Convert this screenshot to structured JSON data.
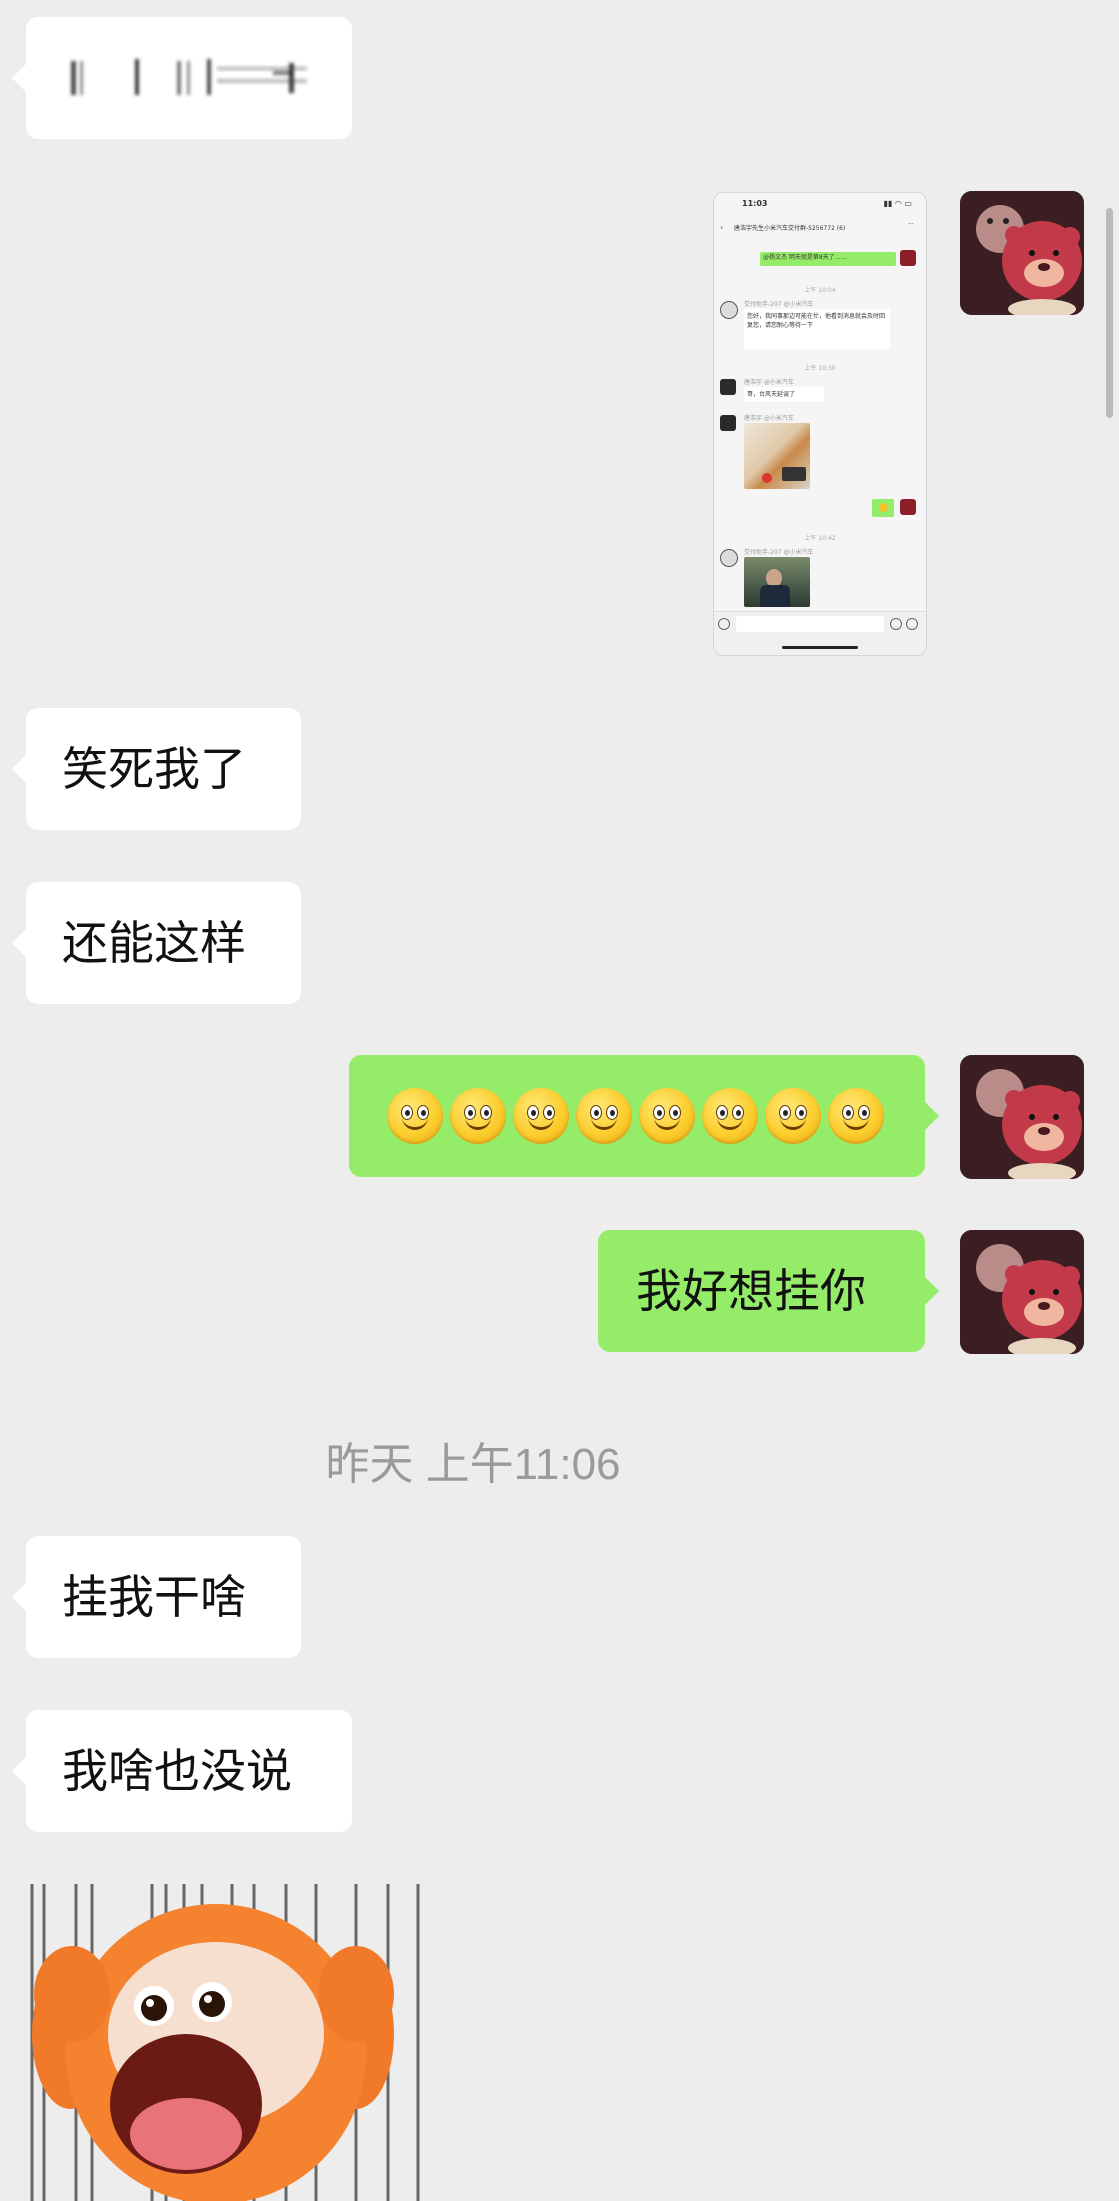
{
  "messages": [
    {
      "id": "m1",
      "side": "in",
      "text": "",
      "redacted": true
    },
    {
      "id": "m2",
      "side": "out",
      "type": "image",
      "screenshot": {
        "time": "11:03",
        "title": "唐浩宇先生小米汽车交付群-5256772 (6)",
        "msg_green": "@杨文杰 明天就是第8天了……",
        "time1": "上午 10:04",
        "sender1": "交付助手-207 @小米汽车",
        "text1": "您好，我同事那边可能在忙，他看到消息就会及时回复您，请您耐心等待一下",
        "time2": "上午 10:30",
        "sender2": "唐浩宇 @小米汽车",
        "text2": "哥，台风天延误了",
        "sender3": "唐浩宇 @小米汽车",
        "time3": "上午 10:42",
        "sender4": "交付助手-207 @小米汽车"
      }
    },
    {
      "id": "m3",
      "side": "in",
      "text": "笑死我了"
    },
    {
      "id": "m4",
      "side": "in",
      "text": "还能这样"
    },
    {
      "id": "m5",
      "side": "out",
      "type": "emoji",
      "emoji": "slightly-smiling-face",
      "count": 8
    },
    {
      "id": "m6",
      "side": "out",
      "text": "我好想挂你"
    },
    {
      "id": "m7",
      "side": "in",
      "text": "挂我干啥"
    },
    {
      "id": "m8",
      "side": "in",
      "text": "我啥也没说"
    },
    {
      "id": "m9",
      "side": "in",
      "type": "sticker",
      "sticker": "orange-monkey-screaming-sticker"
    }
  ],
  "timestamp": "昨天 上午11:06",
  "colors": {
    "background": "#ededed",
    "bubble_in": "#ffffff",
    "bubble_out": "#95ec69",
    "timestamp_text": "#9a9a9a"
  },
  "avatar": {
    "icon": "lotso-bear-avatar"
  }
}
